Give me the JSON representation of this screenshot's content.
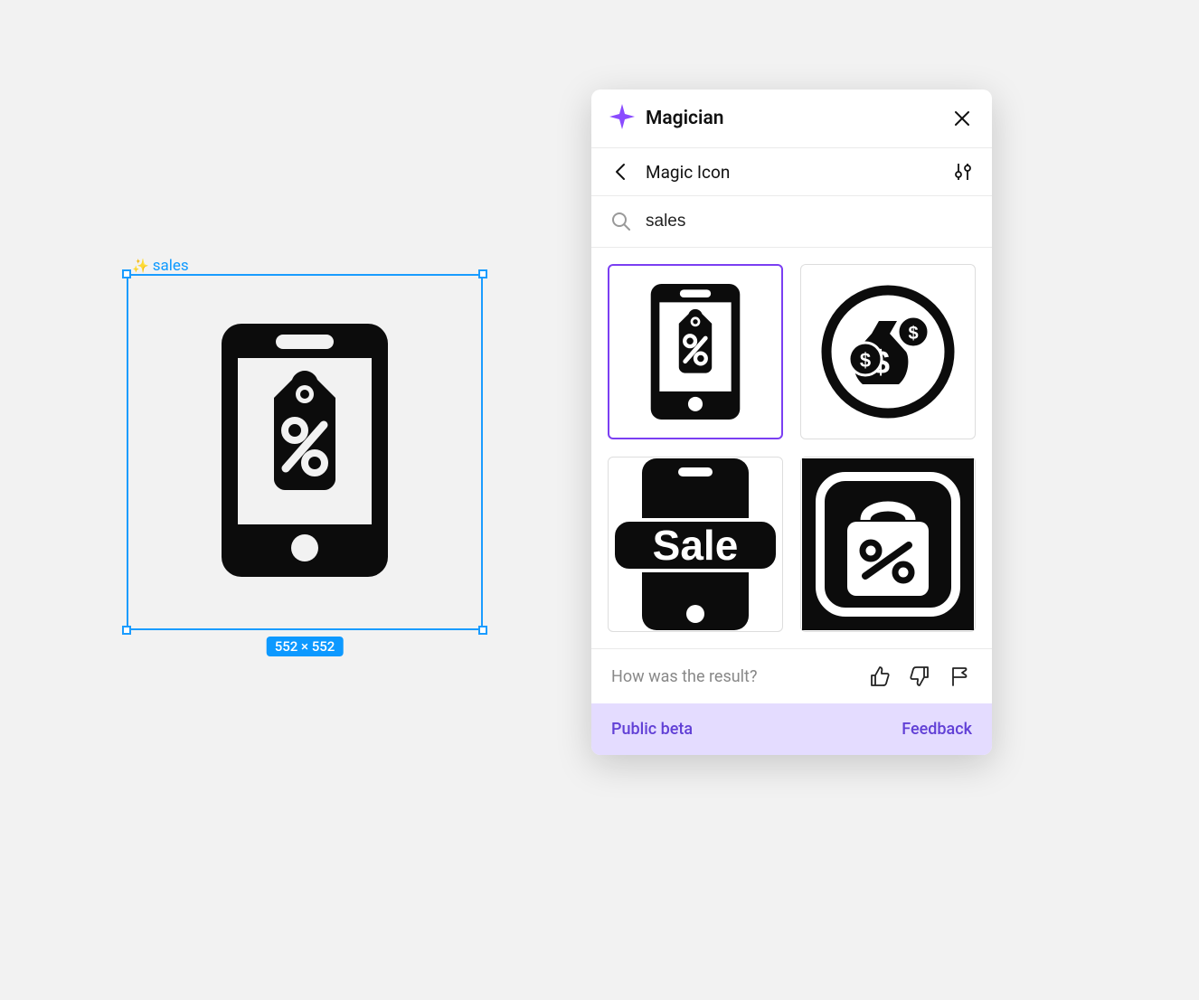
{
  "canvas": {
    "selection_label": "sales",
    "dimensions": "552 × 552"
  },
  "panel": {
    "title": "Magician",
    "nav_title": "Magic Icon",
    "search_value": "sales",
    "results": [
      {
        "name": "phone-sale-tag-icon",
        "selected": true
      },
      {
        "name": "money-bag-circle-icon",
        "selected": false
      },
      {
        "name": "phone-sale-text-icon",
        "selected": false
      },
      {
        "name": "bag-discount-square-icon",
        "selected": false
      }
    ],
    "feedback_prompt": "How was the result?",
    "footer_beta": "Public beta",
    "footer_feedback": "Feedback"
  }
}
